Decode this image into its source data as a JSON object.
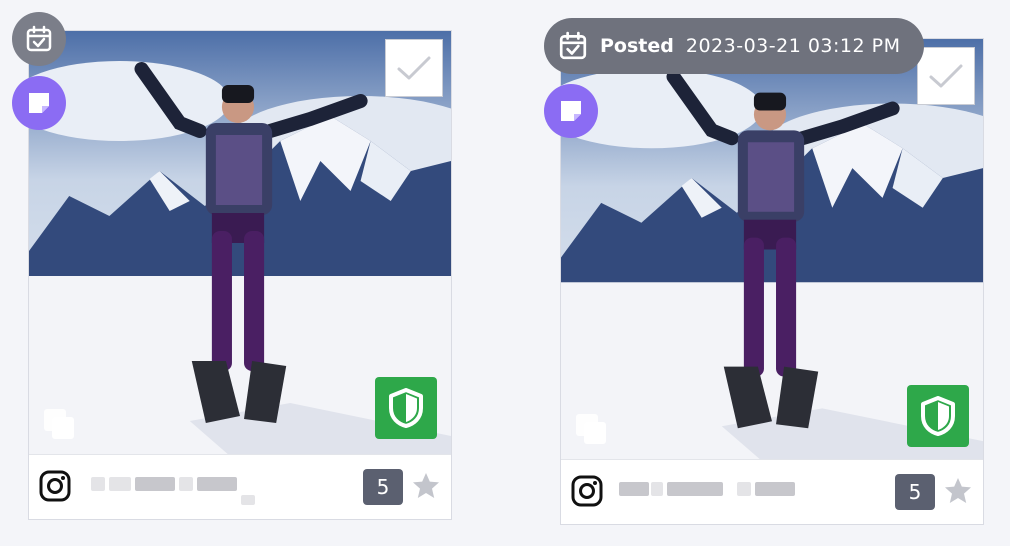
{
  "cards": [
    {
      "posted_label": "",
      "posted_date": "",
      "ugc_count": "5",
      "platform_icon": "instagram-icon",
      "colors": {
        "shield": "#2ea84a",
        "note": "#8b6cf3",
        "count": "#5b6070"
      }
    },
    {
      "posted_label": "Posted",
      "posted_date": "2023-03-21 03:12 PM",
      "ugc_count": "5",
      "platform_icon": "instagram-icon",
      "colors": {
        "shield": "#2ea84a",
        "note": "#8b6cf3",
        "count": "#5b6070"
      }
    }
  ]
}
